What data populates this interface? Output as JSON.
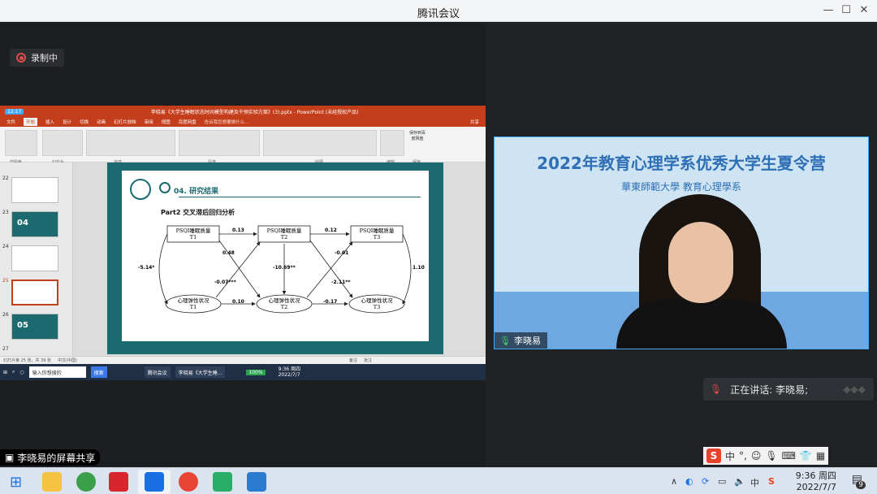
{
  "window": {
    "title": "腾讯会议"
  },
  "recording": {
    "label": "录制中"
  },
  "share": {
    "sharer_label": "李晓易的屏幕共享",
    "ppt": {
      "time_badge": "12:17",
      "window_title": "李晓易《大学生睡眠状态时间模型构建及干预实验方案》(3).pptx - PowerPoint (未经授权产品)",
      "share_label": "共享",
      "tabs": [
        "文件",
        "开始",
        "插入",
        "设计",
        "切换",
        "动画",
        "幻灯片放映",
        "审阅",
        "视图",
        "百度网盘"
      ],
      "search_hint": "告诉我您想要做什么...",
      "ribbon_groups": [
        "剪贴板",
        "幻灯片",
        "字体",
        "段落",
        "绘图",
        "编辑",
        "保存"
      ],
      "save_button": "保存到百度网盘",
      "thumbnails": [
        {
          "num": "22",
          "text": ""
        },
        {
          "num": "23",
          "text": "04"
        },
        {
          "num": "24",
          "text": ""
        },
        {
          "num": "25",
          "text": ""
        },
        {
          "num": "26",
          "text": "05"
        },
        {
          "num": "27",
          "text": ""
        }
      ],
      "slide": {
        "section": "04. 研究结果",
        "subtitle": "Part2 交叉滞后回归分析",
        "nodes": {
          "psqi_t1": [
            "PSQI睡眠质量",
            "T1"
          ],
          "psqi_t2": [
            "PSQI睡眠质量",
            "T2"
          ],
          "psqi_t3": [
            "PSQI睡眠质量",
            "T3"
          ],
          "res_t1": [
            "心理弹性状况",
            "T1"
          ],
          "res_t2": [
            "心理弹性状况",
            "T2"
          ],
          "res_t3": [
            "心理弹性状况",
            "T3"
          ]
        },
        "coefficients": {
          "p12": "0.13",
          "p23": "0.12",
          "r12": "0.10",
          "r23": "-0.17",
          "pt1_rt2": "0.48",
          "rt1_pt2": "-0.07***",
          "pt2_rt3": "-0.01",
          "rt2_pt3": "-2.11**",
          "t1_corr": "-5.14*",
          "t2_corr": "-10.69**",
          "t3_corr": "1.10"
        }
      },
      "status_left": "幻灯片第 25 张，共 39 张",
      "status_lang": "中文(中国)",
      "status_notes": "备注",
      "status_comments": "批注"
    },
    "inner_taskbar": {
      "search_box": "输入你想搜的",
      "search_btn": "搜索",
      "apps": [
        "腾讯会议",
        "李晓易《大学生睡..."
      ],
      "battery": "100%",
      "time": "9:36 周四",
      "date": "2022/7/7"
    }
  },
  "video": {
    "banner": "2022年教育心理学系优秀大学生夏令营",
    "school": "華東師範大學 教育心理學系",
    "name": "李晓易"
  },
  "speaking": {
    "label": "正在讲话: 李晓易;"
  },
  "ime": {
    "items": [
      "中",
      "°,",
      "☺",
      "🎙",
      "⌨",
      "👕",
      "▦"
    ]
  },
  "taskbar": {
    "time": "9:36 周四",
    "date": "2022/7/7",
    "notification_count": "9",
    "ime_lang": "中"
  },
  "colors": {
    "ppt_red": "#c43e1c",
    "slide_teal": "#1b6a70",
    "video_border": "#3fa9ff"
  }
}
